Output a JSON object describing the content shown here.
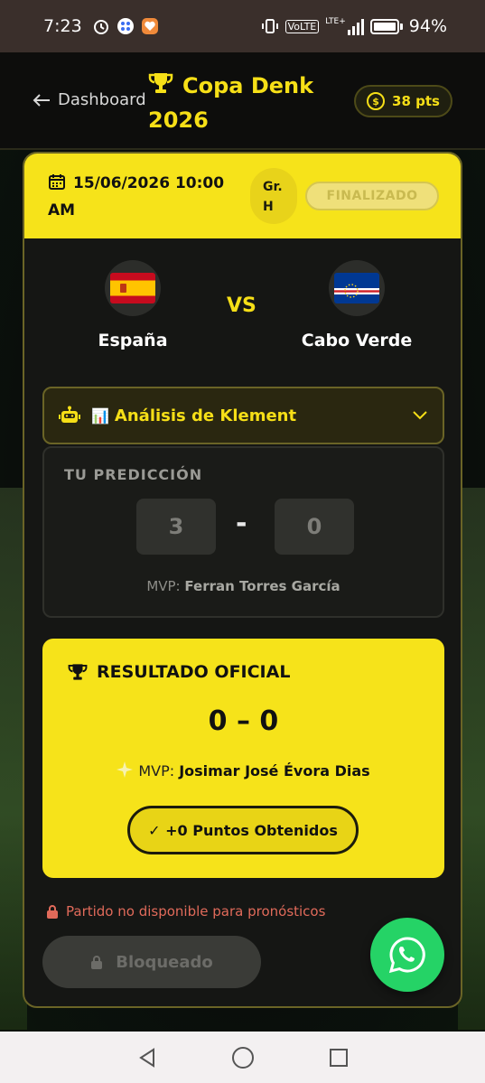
{
  "status_bar": {
    "time": "7:23",
    "battery": "94%",
    "network": "VoLTE",
    "network_type": "LTE+"
  },
  "header": {
    "back_label": "Dashboard",
    "title_line1": "Copa Denk",
    "title_line2": "2026",
    "points": "38 pts",
    "accent": "#f6df17"
  },
  "match": {
    "date_line1": "15/06/2026 10:00",
    "date_line2": "AM",
    "group_line1": "Gr.",
    "group_line2": "H",
    "status": "FINALIZADO",
    "team_a": "España",
    "team_b": "Cabo Verde",
    "vs": "VS"
  },
  "analysis": {
    "label": "Análisis de Klement",
    "chart_glyph": "📊"
  },
  "prediction": {
    "title": "TU PREDICCIÓN",
    "score_a": "3",
    "score_b": "0",
    "separator": "-",
    "mvp_prefix": "MVP: ",
    "mvp_name": "Ferran Torres García"
  },
  "official": {
    "title": "RESULTADO OFICIAL",
    "score": "0 – 0",
    "mvp_prefix": "MVP: ",
    "mvp_name": "Josimar José Évora Dias",
    "points_label": "✓ +0 Puntos Obtenidos"
  },
  "footer": {
    "unavailable": "Partido no disponible para pronósticos",
    "locked_label": "Bloqueado"
  },
  "icons": [
    "back-arrow-icon",
    "trophy-icon",
    "coin-icon",
    "calendar-icon",
    "robot-icon",
    "chevron-down-icon",
    "sparkle-icon",
    "lock-icon",
    "whatsapp-icon"
  ]
}
